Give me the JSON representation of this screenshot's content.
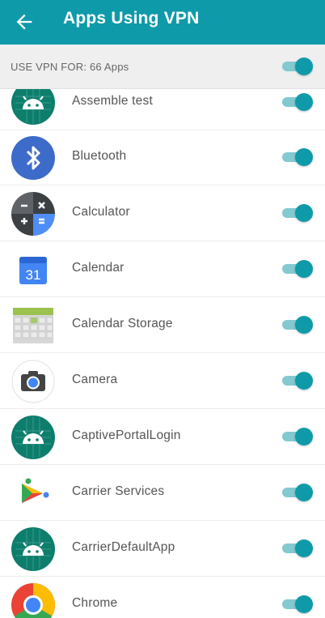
{
  "header": {
    "title": "Apps Using VPN"
  },
  "subheader": {
    "label": "USE VPN FOR: 66 Apps",
    "toggle_on": true
  },
  "apps": [
    {
      "name": "Assemble test",
      "icon": "android-icon",
      "enabled": true
    },
    {
      "name": "Bluetooth",
      "icon": "bluetooth-icon",
      "enabled": true
    },
    {
      "name": "Calculator",
      "icon": "calculator-icon",
      "enabled": true
    },
    {
      "name": "Calendar",
      "icon": "calendar-icon",
      "icon_text": "31",
      "enabled": true
    },
    {
      "name": "Calendar Storage",
      "icon": "calendar-storage-icon",
      "enabled": true
    },
    {
      "name": "Camera",
      "icon": "camera-icon",
      "enabled": true
    },
    {
      "name": "CaptivePortalLogin",
      "icon": "android-icon",
      "enabled": true
    },
    {
      "name": "Carrier Services",
      "icon": "carrier-services-icon",
      "enabled": true
    },
    {
      "name": "CarrierDefaultApp",
      "icon": "android-icon",
      "enabled": true
    },
    {
      "name": "Chrome",
      "icon": "chrome-icon",
      "enabled": true
    }
  ],
  "colors": {
    "appbar": "#0f9aaa",
    "toggle_thumb": "#0f9aaa",
    "toggle_track": "#83c9d0"
  }
}
